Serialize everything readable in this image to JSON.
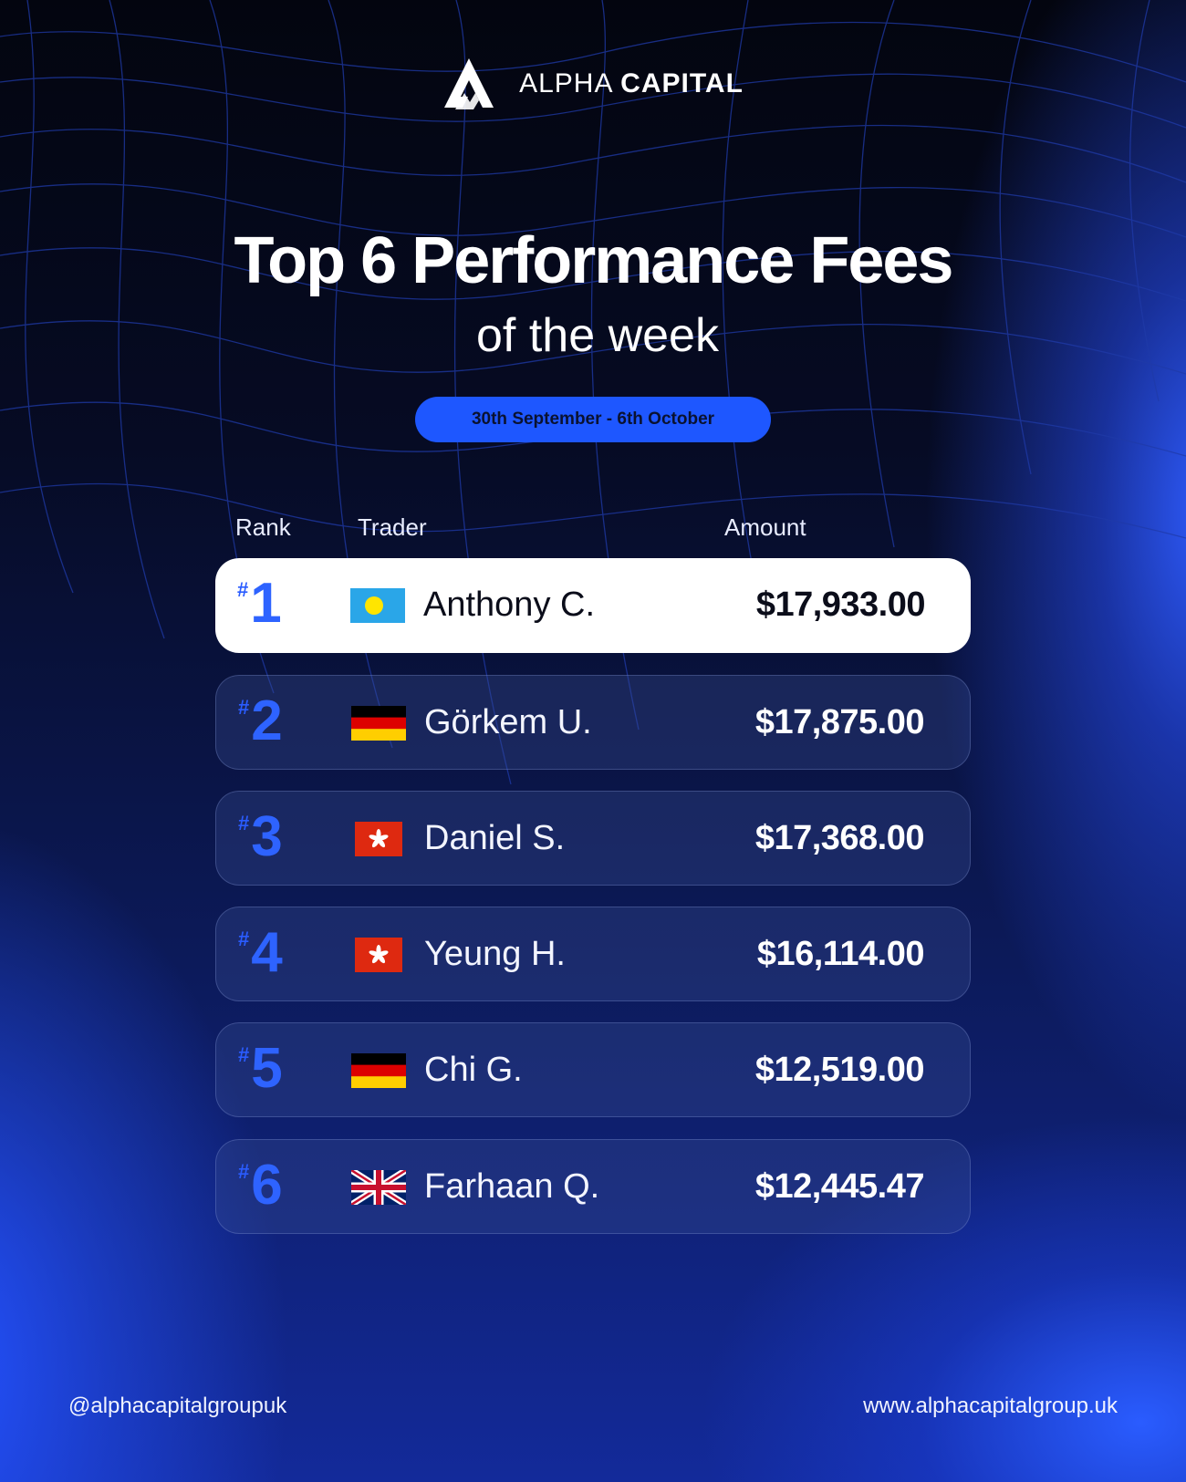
{
  "brand": {
    "word1": "ALPHA",
    "word2": "CAPITAL",
    "logo_icon": "alpha-logo-icon"
  },
  "title": "Top 6 Performance Fees",
  "subtitle": "of the week",
  "date_range": "30th September - 6th October",
  "table": {
    "headers": {
      "rank": "Rank",
      "trader": "Trader",
      "amount": "Amount"
    },
    "rows": [
      {
        "hash": "#",
        "rank": "1",
        "flag": "palau-flag-icon",
        "name": "Anthony C.",
        "amount": "$17,933.00"
      },
      {
        "hash": "#",
        "rank": "2",
        "flag": "germany-flag-icon",
        "name": "Görkem U.",
        "amount": "$17,875.00"
      },
      {
        "hash": "#",
        "rank": "3",
        "flag": "hong-kong-flag-icon",
        "name": "Daniel S.",
        "amount": "$17,368.00"
      },
      {
        "hash": "#",
        "rank": "4",
        "flag": "hong-kong-flag-icon",
        "name": "Yeung H.",
        "amount": "$16,114.00"
      },
      {
        "hash": "#",
        "rank": "5",
        "flag": "germany-flag-icon",
        "name": "Chi G.",
        "amount": "$12,519.00"
      },
      {
        "hash": "#",
        "rank": "6",
        "flag": "united-kingdom-flag-icon",
        "name": "Farhaan Q.",
        "amount": "$12,445.47"
      }
    ]
  },
  "footer": {
    "handle": "@alphacapitalgroupuk",
    "website": "www.alphacapitalgroup.uk"
  },
  "colors": {
    "accent": "#1e57ff",
    "rank_blue": "#2e63ff",
    "background_dark": "#03050f"
  }
}
